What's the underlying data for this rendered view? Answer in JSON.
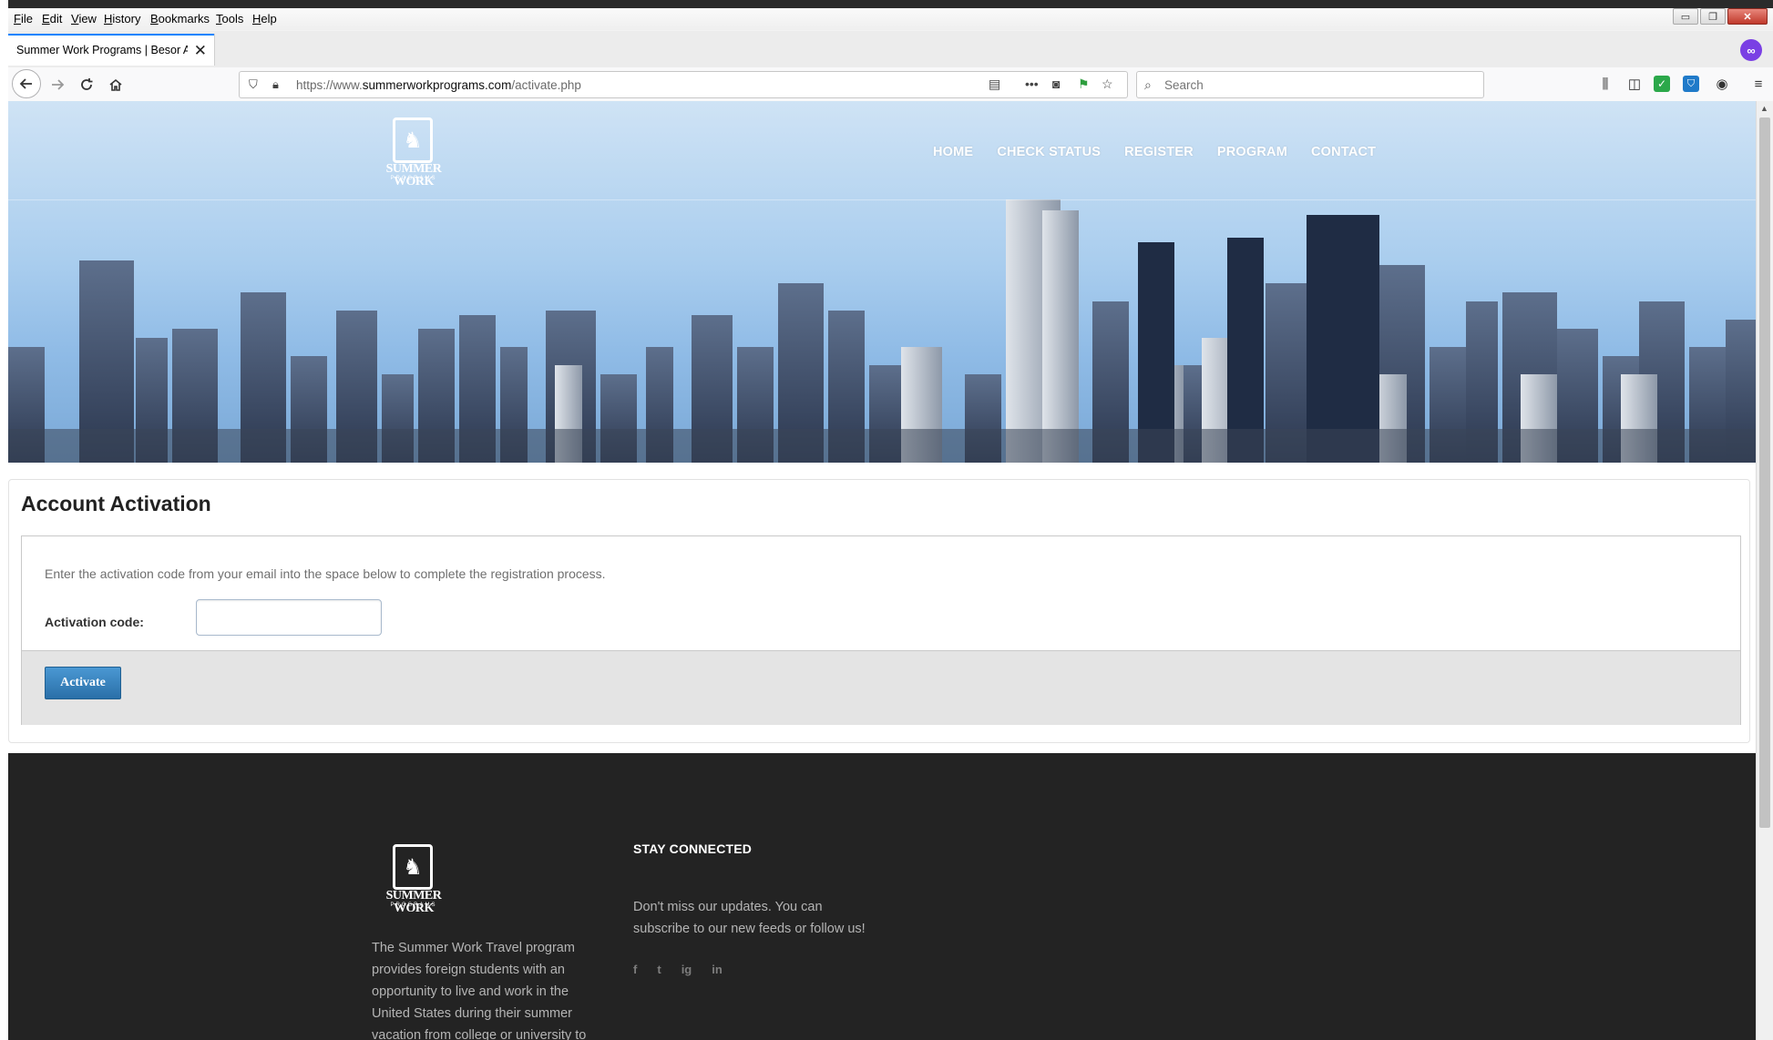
{
  "browser": {
    "menu": [
      "File",
      "Edit",
      "View",
      "History",
      "Bookmarks",
      "Tools",
      "Help"
    ],
    "tab_title": "Summer Work Programs | Besor As",
    "tab_close": "✕",
    "url_prefix": "https://www.",
    "url_domain": "summerworkprograms.com",
    "url_path": "/activate.php",
    "search_placeholder": "Search"
  },
  "site": {
    "logo_text": "SUMMER WORK",
    "logo_sub": "PROGRAMS",
    "nav": [
      "HOME",
      "CHECK STATUS",
      "REGISTER",
      "PROGRAM",
      "CONTACT"
    ]
  },
  "main": {
    "title": "Account Activation",
    "instructions": "Enter the activation code from your email into the space below to complete the registration process.",
    "field_label": "Activation code:",
    "field_value": "",
    "submit_label": "Activate"
  },
  "footer": {
    "about": "The Summer Work Travel program provides foreign students with an opportunity to live and work in the United States during their summer vacation from college or university to",
    "heading": "STAY CONNECTED",
    "text": "Don't miss our updates. You can subscribe to our new feeds or follow us!",
    "social": [
      "f",
      "t",
      "ig",
      "in"
    ]
  }
}
